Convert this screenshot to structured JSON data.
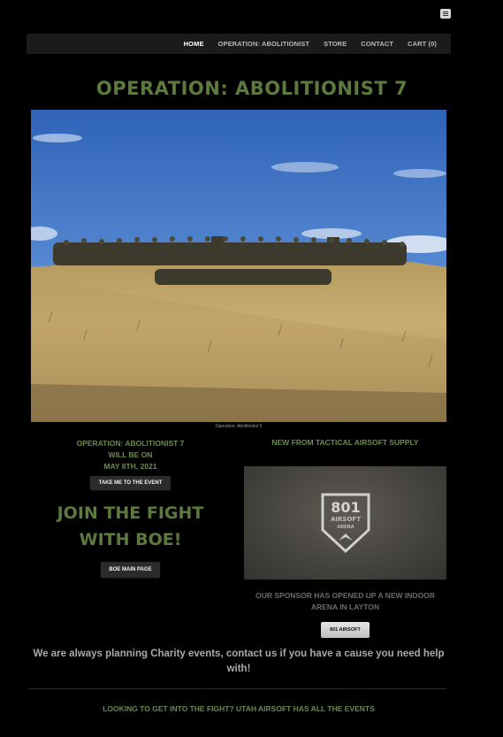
{
  "nav": {
    "items": [
      {
        "label": "HOME",
        "active": true
      },
      {
        "label": "OPERATION: ABOLITIONIST",
        "active": false
      },
      {
        "label": "STORE",
        "active": false
      },
      {
        "label": "CONTACT",
        "active": false
      },
      {
        "label": "CART (0)",
        "active": false
      }
    ]
  },
  "page": {
    "title": "OPERATION: ABOLITIONIST 7",
    "hero_caption": "Operation: Abolitionist 5"
  },
  "event": {
    "line1": "OPERATION: ABOLITIONIST 7",
    "line2": "WILL BE ON",
    "line3": "MAY 8TH, 2021",
    "button": "TAKE ME TO THE EVENT"
  },
  "join": {
    "line1": "JOIN THE FIGHT",
    "line2": "WITH BOE!",
    "button": "BOE MAIN PAGE"
  },
  "sponsor": {
    "heading": "NEW FROM TACTICAL AIRSOFT SUPPLY",
    "logo_number": "801",
    "logo_line1": "AIRSOFT",
    "logo_line2": "ARENA",
    "text": "OUR SPONSOR HAS OPENED UP A NEW INDOOR ARENA IN LAYTON",
    "button": "801 AIRSOFT"
  },
  "charity": "We are always planning Charity events, contact us if you have a cause you need help with!",
  "footer": {
    "link": "LOOKING TO GET INTO THE FIGHT? UTAH AIRSOFT HAS ALL THE EVENTS"
  },
  "colors": {
    "accent_green": "#5c7a3e",
    "nav_bg": "#1b1b1b",
    "background": "#000000"
  },
  "icons": {
    "menu": "hamburger-icon",
    "logo": "shield-badge-icon"
  }
}
